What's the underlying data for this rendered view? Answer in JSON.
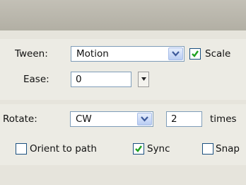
{
  "tween": {
    "label": "Tween:",
    "value": "Motion"
  },
  "scale": {
    "label": "Scale",
    "checked": true
  },
  "ease": {
    "label": "Ease:",
    "value": "0"
  },
  "rotate": {
    "label": "Rotate:",
    "value": "CW",
    "count": "2",
    "unit_label": "times"
  },
  "orient": {
    "label": "Orient to path",
    "checked": false
  },
  "sync": {
    "label": "Sync",
    "checked": true
  },
  "snap": {
    "label": "Snap",
    "checked": false
  },
  "icons": {
    "dropdown": "chevron-down-icon",
    "stepper": "triangle-down-icon",
    "check": "checkmark-icon"
  },
  "colors": {
    "field_border": "#7f9db9",
    "checkbox_border": "#1c5180",
    "check_mark": "#21a121"
  }
}
